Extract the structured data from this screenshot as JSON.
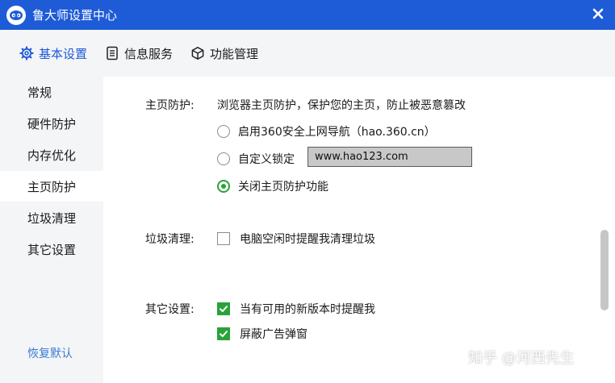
{
  "window": {
    "title": "鲁大师设置中心"
  },
  "tabs": [
    {
      "label": "基本设置",
      "icon": "gear-icon",
      "active": true
    },
    {
      "label": "信息服务",
      "icon": "document-icon",
      "active": false
    },
    {
      "label": "功能管理",
      "icon": "cube-icon",
      "active": false
    }
  ],
  "sidebar": {
    "items": [
      {
        "label": "常规"
      },
      {
        "label": "硬件防护"
      },
      {
        "label": "内存优化"
      },
      {
        "label": "主页防护",
        "active": true
      },
      {
        "label": "垃圾清理"
      },
      {
        "label": "其它设置"
      }
    ],
    "restore_label": "恢复默认"
  },
  "homepage": {
    "label": "主页防护:",
    "description": "浏览器主页防护，保护您的主页，防止被恶意篡改",
    "options": [
      {
        "label": "启用360安全上网导航（hao.360.cn）",
        "selected": false
      },
      {
        "label": "自定义锁定",
        "selected": false
      },
      {
        "label": "关闭主页防护功能",
        "selected": true
      }
    ],
    "custom_url": "www.hao123.com"
  },
  "cleanup": {
    "label": "垃圾清理:",
    "options": [
      {
        "label": "电脑空闲时提醒我清理垃圾",
        "checked": false
      }
    ]
  },
  "other": {
    "label": "其它设置:",
    "options": [
      {
        "label": "当有可用的新版本时提醒我",
        "checked": true
      },
      {
        "label": "屏蔽广告弹窗",
        "checked": true
      }
    ]
  },
  "watermark": "知乎 @河西先生",
  "colors": {
    "title_bar": "#1e5bd7",
    "accent": "#1e5bd7",
    "check_green": "#2aa23a",
    "link_blue": "#3a7bd5"
  }
}
